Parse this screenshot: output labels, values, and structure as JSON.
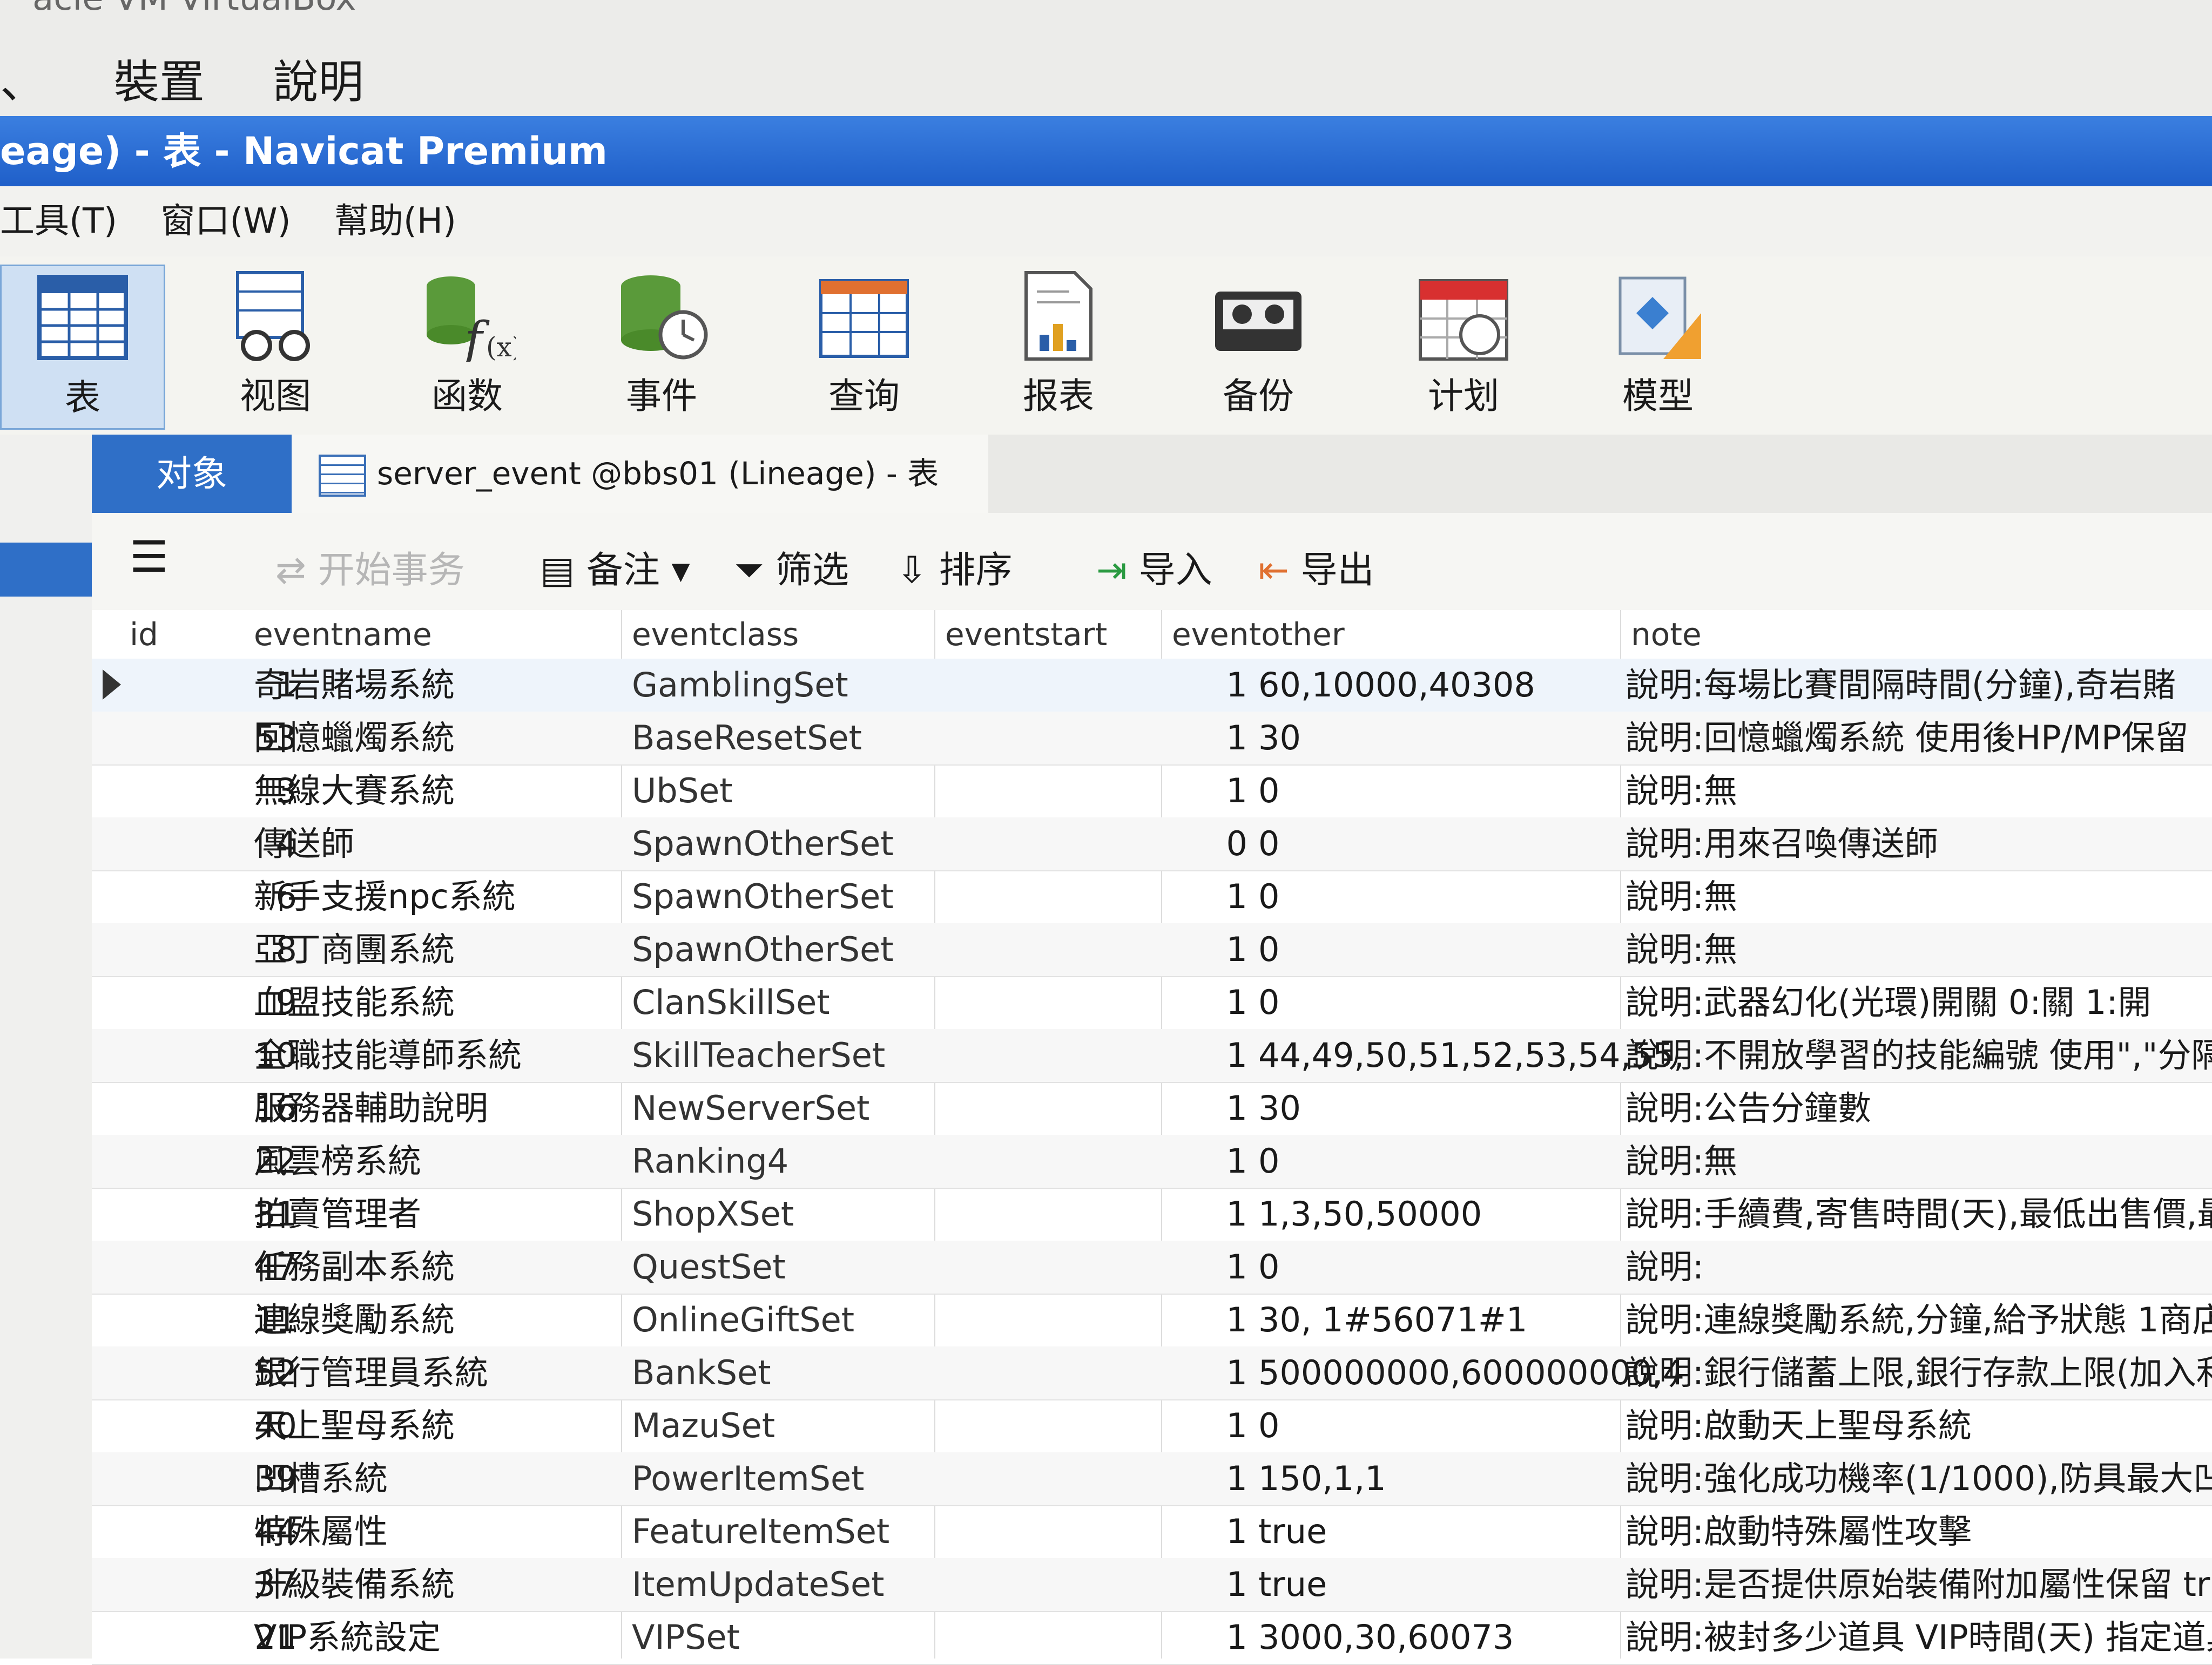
{
  "vbox": {
    "title": "acle VM VirtualBox",
    "menu": [
      "、",
      "裝置",
      "說明"
    ]
  },
  "window": {
    "title": "eage) - 表 - Navicat Premium"
  },
  "menubar": [
    "工具(T)",
    "窗口(W)",
    "幫助(H)"
  ],
  "toolbar": [
    {
      "label": "表",
      "icon": "table-icon"
    },
    {
      "label": "视图",
      "icon": "view-icon"
    },
    {
      "label": "函数",
      "icon": "function-icon"
    },
    {
      "label": "事件",
      "icon": "event-icon"
    },
    {
      "label": "查询",
      "icon": "query-icon"
    },
    {
      "label": "报表",
      "icon": "report-icon"
    },
    {
      "label": "备份",
      "icon": "backup-icon"
    },
    {
      "label": "计划",
      "icon": "schedule-icon"
    },
    {
      "label": "模型",
      "icon": "model-icon"
    }
  ],
  "tabs": {
    "objects": "对象",
    "table_tab": "server_event @bbs01 (Lineage) - 表"
  },
  "subbar": {
    "begin_tx": "开始事务",
    "memo": "备注",
    "filter": "筛选",
    "sort": "排序",
    "import": "导入",
    "export": "导出"
  },
  "columns": [
    "id",
    "eventname",
    "eventclass",
    "eventstart",
    "eventother",
    "note"
  ],
  "rows": [
    [
      "1",
      "奇岩賭場系統",
      "GamblingSet",
      "1",
      "60,10000,40308",
      "說明:每場比賽間隔時間(分鐘),奇岩賭"
    ],
    [
      "53",
      "回憶蠟燭系統",
      "BaseResetSet",
      "1",
      "30",
      "說明:回憶蠟燭系統 使用後HP/MP保留"
    ],
    [
      "3",
      "無線大賽系統",
      "UbSet",
      "1",
      "0",
      "說明:無"
    ],
    [
      "4",
      "傳送師",
      "SpawnOtherSet",
      "0",
      "0",
      "說明:用來召喚傳送師"
    ],
    [
      "6",
      "新手支援npc系統",
      "SpawnOtherSet",
      "1",
      "0",
      "說明:無"
    ],
    [
      "8",
      "亞丁商團系統",
      "SpawnOtherSet",
      "1",
      "0",
      "說明:無"
    ],
    [
      "9",
      "血盟技能系統",
      "ClanSkillSet",
      "1",
      "0",
      "說明:武器幻化(光環)開關 0:關 1:開"
    ],
    [
      "10",
      "全職技能導師系統",
      "SkillTeacherSet",
      "1",
      "44,49,50,51,52,53,54,55,56,57,",
      "說明:不開放學習的技能編號 使用\",\"分隔"
    ],
    [
      "16",
      "服務器輔助說明",
      "NewServerSet",
      "1",
      "30",
      "說明:公告分鐘數"
    ],
    [
      "22",
      "風雲榜系統",
      "Ranking4",
      "1",
      "0",
      "說明:無"
    ],
    [
      "31",
      "拍賣管理者",
      "ShopXSet",
      "1",
      "1,3,50,50000",
      "說明:手續費,寄售時間(天),最低出售價,最"
    ],
    [
      "47",
      "任務副本系統",
      "QuestSet",
      "1",
      "0",
      "說明:"
    ],
    [
      "11",
      "連線獎勵系統",
      "OnlineGiftSet",
      "1",
      "30, 1#56071#1",
      "說明:連線獎勵系統,分鐘,給予狀態 1商店"
    ],
    [
      "52",
      "銀行管理員系統",
      "BankSet",
      "1",
      "500000000,600000000,40308,",
      "說明:銀行儲蓄上限,銀行存款上限(加入利"
    ],
    [
      "40",
      "天上聖母系統",
      "MazuSet",
      "1",
      "0",
      "說明:啟動天上聖母系統"
    ],
    [
      "39",
      "凹槽系統",
      "PowerItemSet",
      "1",
      "150,1,1",
      "說明:強化成功機率(1/1000),防具最大凹槽"
    ],
    [
      "44",
      "特殊屬性",
      "FeatureItemSet",
      "1",
      "true",
      "說明:啟動特殊屬性攻擊"
    ],
    [
      "37",
      "升級裝備系統",
      "ItemUpdateSet",
      "1",
      "true",
      "說明:是否提供原始裝備附加屬性保留 true"
    ],
    [
      "21",
      "VIP系統設定",
      "VIPSet",
      "1",
      "3000,30,60073",
      "說明:被封多少道具 VIP時間(天) 指定道具"
    ]
  ]
}
